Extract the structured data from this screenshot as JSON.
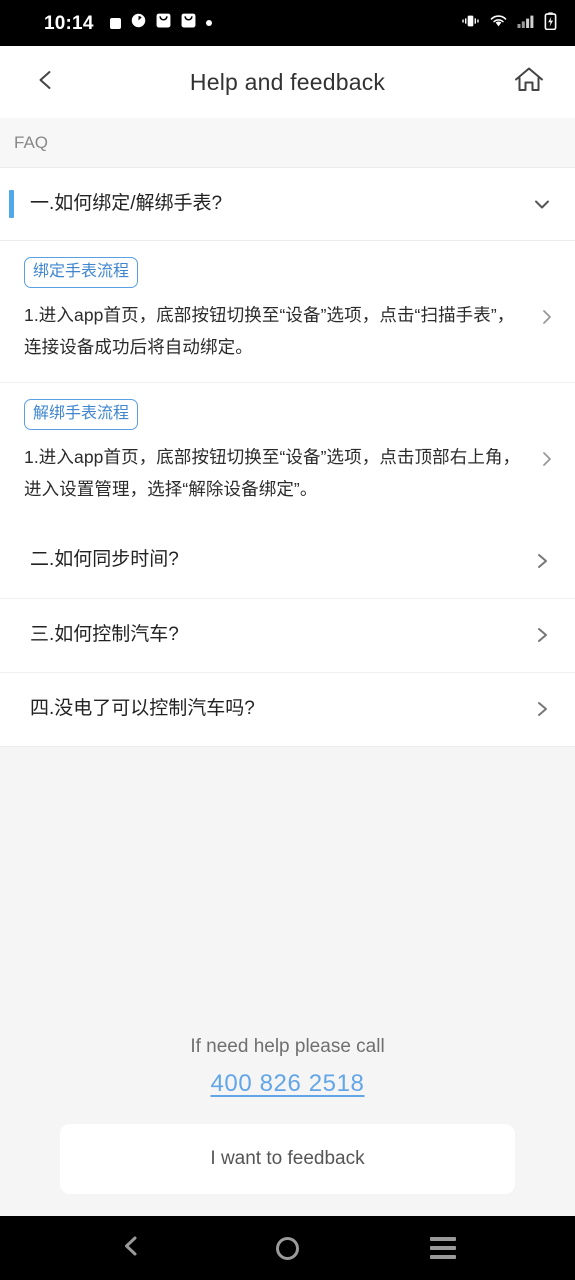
{
  "statusbar": {
    "time": "10:14",
    "left_icons": [
      "stop-square-icon",
      "alarm-clock-icon",
      "app-notification-icon",
      "app-notification-icon",
      "dot-icon"
    ],
    "right_icons": [
      "vibrate-icon",
      "wifi-icon",
      "signal-bars-icon",
      "battery-charging-icon"
    ]
  },
  "header": {
    "back_icon": "chevron-left-icon",
    "title": "Help and feedback",
    "home_icon": "home-icon"
  },
  "section": {
    "faq_label": "FAQ"
  },
  "faq": [
    {
      "title": "一.如何绑定/解绑手表?",
      "expanded": true,
      "chevron": "chevron-down-icon",
      "answers": [
        {
          "badge": "绑定手表流程",
          "text": "1.进入app首页，底部按钮切换至“设备”选项，点击“扫描手表”，连接设备成功后将自动绑定。",
          "chevron": "chevron-right-icon"
        },
        {
          "badge": "解绑手表流程",
          "text": "1.进入app首页，底部按钮切换至“设备”选项，点击顶部右上角，进入设置管理，选择“解除设备绑定”。",
          "chevron": "chevron-right-icon"
        }
      ]
    },
    {
      "title": "二.如何同步时间?",
      "expanded": false,
      "chevron": "chevron-right-icon",
      "answers": []
    },
    {
      "title": "三.如何控制汽车?",
      "expanded": false,
      "chevron": "chevron-right-icon",
      "answers": []
    },
    {
      "title": "四.没电了可以控制汽车吗?",
      "expanded": false,
      "chevron": "chevron-right-icon",
      "answers": []
    }
  ],
  "footer": {
    "call_label": "If need help please call",
    "phone": "400 826 2518",
    "feedback_button": "I want to feedback"
  },
  "navbar": {
    "back_icon": "nav-back-icon",
    "home_icon": "nav-home-icon",
    "recents_icon": "nav-recents-icon"
  },
  "colors": {
    "accent_blue": "#4fa8e8",
    "link_blue": "#63a6e8",
    "badge_blue": "#3f86cf",
    "page_bg": "#f5f5f5"
  }
}
